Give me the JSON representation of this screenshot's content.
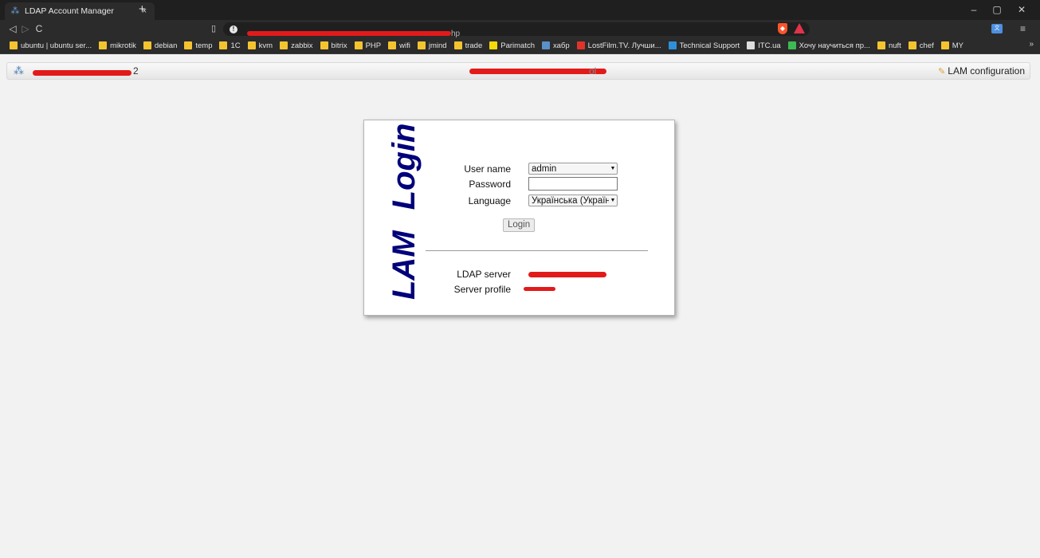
{
  "browser": {
    "tab_title": "LDAP Account Manager",
    "tab_close": "×",
    "new_tab": "+",
    "window_controls": [
      "–",
      "▢",
      "✕"
    ],
    "nav": {
      "back": "◁",
      "forward": "▷",
      "reload": "C"
    },
    "url_visible_fragment": "hp",
    "bookmarks": [
      {
        "label": "ubuntu | ubuntu ser...",
        "icon": "folder"
      },
      {
        "label": "mikrotik",
        "icon": "folder"
      },
      {
        "label": "debian",
        "icon": "folder"
      },
      {
        "label": "temp",
        "icon": "folder"
      },
      {
        "label": "1C",
        "icon": "folder"
      },
      {
        "label": "kvm",
        "icon": "folder"
      },
      {
        "label": "zabbix",
        "icon": "folder"
      },
      {
        "label": "bitrix",
        "icon": "folder"
      },
      {
        "label": "PHP",
        "icon": "folder"
      },
      {
        "label": "wifi",
        "icon": "folder"
      },
      {
        "label": "jmind",
        "icon": "folder"
      },
      {
        "label": "trade",
        "icon": "folder"
      },
      {
        "label": "Parimatch",
        "icon": "parimatch",
        "color": "#f5d90a"
      },
      {
        "label": "хабр",
        "icon": "habr",
        "color": "#5b8fc7"
      },
      {
        "label": "LostFilm.TV. Лучши...",
        "icon": "lostfilm",
        "color": "#e0332a"
      },
      {
        "label": "Technical Support",
        "icon": "diamond",
        "color": "#2f8fd8"
      },
      {
        "label": "ITC.ua",
        "icon": "itc",
        "color": "#dddddd"
      },
      {
        "label": "Хочу научиться пр...",
        "icon": "globe",
        "color": "#3cba54"
      },
      {
        "label": "nuft",
        "icon": "folder"
      },
      {
        "label": "chef",
        "icon": "folder"
      },
      {
        "label": "MY",
        "icon": "folder"
      }
    ],
    "bookmarks_more": "»"
  },
  "header": {
    "app_title_visible": "2",
    "center_text_visible": "ol",
    "config_label": "LAM configuration"
  },
  "login": {
    "title_words": [
      "LAM",
      "Login"
    ],
    "user_label": "User name",
    "user_value": "admin",
    "password_label": "Password",
    "language_label": "Language",
    "language_value": "Українська (Україна)",
    "login_button": "Login",
    "ldap_server_label": "LDAP server",
    "server_profile_label": "Server profile"
  },
  "colors": {
    "title_blue": "#00007a",
    "redaction": "#e31a1a",
    "chrome_dark": "#2b2b2b"
  }
}
